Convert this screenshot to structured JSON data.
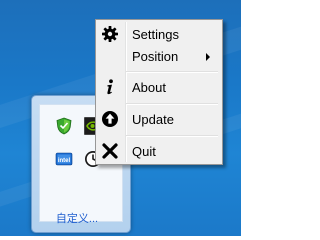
{
  "context_menu": {
    "items": [
      {
        "label": "Settings",
        "icon": "gear-icon"
      },
      {
        "label": "Position",
        "icon": "",
        "submenu": true
      },
      {
        "label": "About",
        "icon": "info-icon"
      },
      {
        "label": "Update",
        "icon": "upload-arrow-icon"
      },
      {
        "label": "Quit",
        "icon": "close-x-icon"
      }
    ]
  },
  "tray_panel": {
    "icons": [
      "shield-icon",
      "nvidia-icon",
      "intel-icon",
      "clock-icon"
    ],
    "customize_label": "自定义..."
  },
  "colors": {
    "desktop_blue": "#1a78c8",
    "menu_background": "#f0f0f0",
    "link_blue": "#1e5ecf",
    "shield_green": "#3aa82f",
    "nvidia_green": "#76b900",
    "intel_blue": "#1a6bd0"
  }
}
